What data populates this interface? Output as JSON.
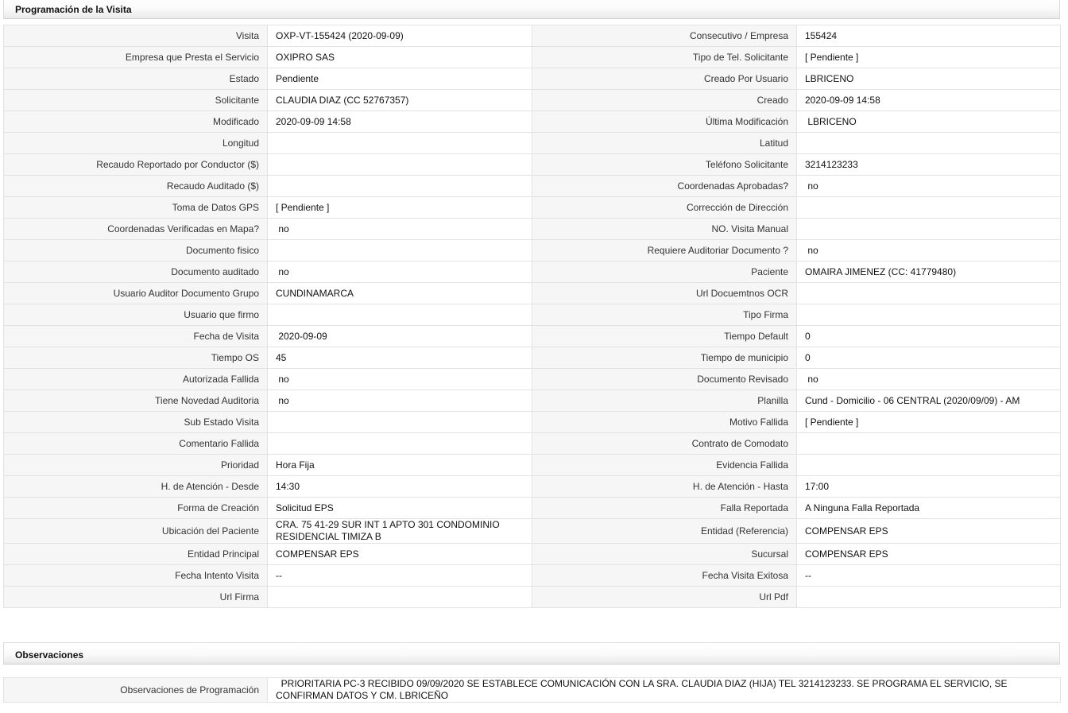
{
  "programacion": {
    "title": "Programación de la Visita",
    "rows": [
      {
        "l1": "Visita",
        "v1": "OXP-VT-155424 (2020-09-09)",
        "l2": "Consecutivo / Empresa",
        "v2": "155424"
      },
      {
        "l1": "Empresa que Presta el Servicio",
        "v1": "OXIPRO SAS",
        "l2": "Tipo de Tel. Solicitante",
        "v2": "[ Pendiente ]"
      },
      {
        "l1": "Estado",
        "v1": "Pendiente",
        "l2": "Creado Por Usuario",
        "v2": "LBRICENO"
      },
      {
        "l1": "Solicitante",
        "v1": "CLAUDIA DIAZ (CC 52767357)",
        "l2": "Creado",
        "v2": "2020-09-09 14:58"
      },
      {
        "l1": "Modificado",
        "v1": "2020-09-09 14:58",
        "l2": "Última Modificación",
        "v2": " LBRICENO"
      },
      {
        "l1": "Longitud",
        "v1": "",
        "l2": "Latitud",
        "v2": ""
      },
      {
        "l1": "Recaudo Reportado por Conductor ($)",
        "v1": "",
        "l2": "Teléfono Solicitante",
        "v2": "3214123233"
      },
      {
        "l1": "Recaudo Auditado ($)",
        "v1": "",
        "l2": "Coordenadas Aprobadas?",
        "v2": " no"
      },
      {
        "l1": "Toma de Datos GPS",
        "v1": "[ Pendiente ]",
        "l2": "Corrección de Dirección",
        "v2": ""
      },
      {
        "l1": "Coordenadas Verificadas en Mapa?",
        "v1": " no",
        "l2": "NO. Visita Manual",
        "v2": ""
      },
      {
        "l1": "Documento fisico",
        "v1": "",
        "l2": "Requiere Auditoriar Documento ?",
        "v2": " no"
      },
      {
        "l1": "Documento auditado",
        "v1": " no",
        "l2": "Paciente",
        "v2": "OMAIRA JIMENEZ (CC: 41779480)"
      },
      {
        "l1": "Usuario Auditor Documento Grupo",
        "v1": "CUNDINAMARCA",
        "l2": "Url Docuemtnos OCR",
        "v2": ""
      },
      {
        "l1": "Usuario que firmo",
        "v1": "",
        "l2": "Tipo Firma",
        "v2": ""
      },
      {
        "l1": "Fecha de Visita",
        "v1": " 2020-09-09",
        "l2": "Tiempo Default",
        "v2": "0"
      },
      {
        "l1": "Tiempo OS",
        "v1": "45",
        "l2": "Tiempo de municipio",
        "v2": "0"
      },
      {
        "l1": "Autorizada Fallida",
        "v1": " no",
        "l2": "Documento Revisado",
        "v2": " no"
      },
      {
        "l1": "Tiene Novedad Auditoria",
        "v1": " no",
        "l2": "Planilla",
        "v2": "Cund - Domicilio - 06 CENTRAL (2020/09/09) - AM"
      },
      {
        "l1": "Sub Estado Visita",
        "v1": "",
        "l2": "Motivo Fallida",
        "v2": "[ Pendiente ]"
      },
      {
        "l1": "Comentario Fallida",
        "v1": "",
        "l2": "Contrato de Comodato",
        "v2": ""
      },
      {
        "l1": "Prioridad",
        "v1": "Hora Fija",
        "l2": "Evidencia Fallida",
        "v2": ""
      },
      {
        "l1": "H. de Atención - Desde",
        "v1": "14:30",
        "l2": "H. de Atención - Hasta",
        "v2": "17:00"
      },
      {
        "l1": "Forma de Creación",
        "v1": "Solicitud EPS",
        "l2": "Falla Reportada",
        "v2": "A Ninguna Falla Reportada"
      },
      {
        "l1": "Ubicación del Paciente",
        "v1": "CRA. 75 41-29 SUR INT 1 APTO 301 CONDOMINIO RESIDENCIAL TIMIZA B",
        "l2": "Entidad (Referencia)",
        "v2": "COMPENSAR EPS"
      },
      {
        "l1": "Entidad Principal",
        "v1": "COMPENSAR EPS",
        "l2": "Sucursal",
        "v2": "COMPENSAR EPS"
      },
      {
        "l1": "Fecha Intento Visita",
        "v1": "--",
        "l2": "Fecha Visita Exitosa",
        "v2": "--"
      },
      {
        "l1": "Url Firma",
        "v1": "",
        "l2": "Url Pdf",
        "v2": ""
      }
    ]
  },
  "observaciones": {
    "title": "Observaciones",
    "label": "Observaciones de Programación",
    "value": "  PRIORITARIA PC-3 RECIBIDO 09/09/2020 SE ESTABLECE COMUNICACIÓN CON LA SRA. CLAUDIA DIAZ (HIJA) TEL 3214123233. SE PROGRAMA EL SERVICIO, SE CONFIRMAN DATOS Y CM. LBRICEÑO"
  }
}
